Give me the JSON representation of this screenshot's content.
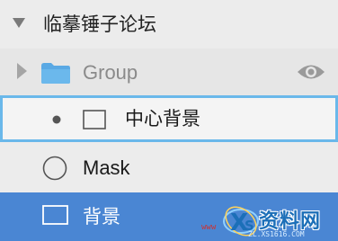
{
  "layers": {
    "artboard": {
      "label": "临摹锤子论坛",
      "state": "expanded"
    },
    "group": {
      "label": "Group",
      "state": "collapsed",
      "visibility_icon": "eye-icon"
    },
    "central_bg": {
      "label": "中心背景",
      "state": "selected-outline"
    },
    "mask": {
      "label": "Mask"
    },
    "background": {
      "label": "背景",
      "state": "selected"
    }
  },
  "watermark": {
    "brand": "资料网",
    "url": "ZL.XS1616.COM",
    "prefix": "www"
  },
  "colors": {
    "selection_blue": "#4a86d3",
    "outline_blue": "#6ab8ea",
    "folder_blue": "#64afe6",
    "muted_text": "#8a8a8a"
  }
}
